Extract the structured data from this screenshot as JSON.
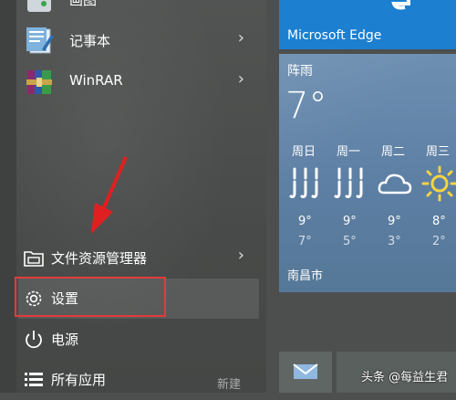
{
  "apps": [
    {
      "label": "画图",
      "icon": "paint-icon"
    },
    {
      "label": "记事本",
      "icon": "notepad-icon"
    },
    {
      "label": "WinRAR",
      "icon": "winrar-icon"
    }
  ],
  "system": {
    "file_explorer": "文件资源管理器",
    "settings": "设置",
    "power": "电源",
    "all_apps": "所有应用",
    "new_label": "新建"
  },
  "tiles": {
    "edge_label": "Microsoft Edge",
    "weather": {
      "condition": "阵雨",
      "temp": "7°",
      "city": "南昌市",
      "days": [
        {
          "name": "周日",
          "icon": "rain-icon",
          "hi": "9°",
          "lo": "7°"
        },
        {
          "name": "周一",
          "icon": "rain-icon",
          "hi": "9°",
          "lo": "5°"
        },
        {
          "name": "周二",
          "icon": "cloud-icon",
          "hi": "9°",
          "lo": "3°"
        },
        {
          "name": "周三",
          "icon": "sun-icon",
          "hi": "8°",
          "lo": "2°"
        }
      ]
    }
  },
  "watermark": "头条 @每益生君",
  "colors": {
    "edge_tile": "#1c7fd0",
    "weather_tile": "#6d8fb1",
    "highlight_box": "#e23b3b",
    "arrow": "#e02020"
  }
}
